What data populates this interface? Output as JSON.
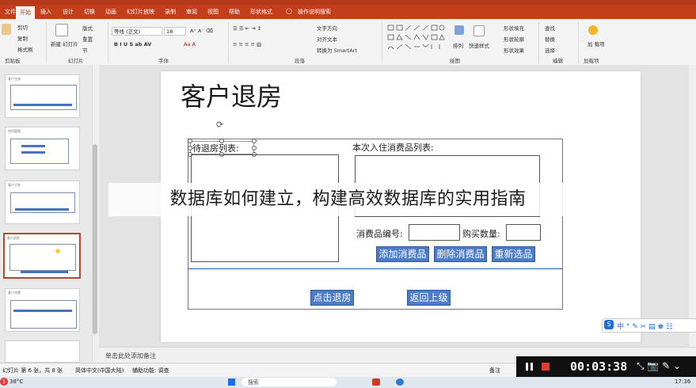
{
  "tabs": [
    "文件",
    "开始",
    "插入",
    "设计",
    "切换",
    "动画",
    "幻灯片放映",
    "录制",
    "审阅",
    "视图",
    "帮助",
    "形状格式"
  ],
  "tab_active": "开始",
  "search_hint": "操作说明搜索",
  "ribbon": {
    "clipboard": {
      "paste": "粘贴",
      "cut": "剪切",
      "copy": "复制",
      "format_painter": "格式刷",
      "label": "剪贴板"
    },
    "slides": {
      "new_slide": "新建\n幻灯片",
      "layout": "版式",
      "reset": "重置",
      "section": "节",
      "label": "幻灯片"
    },
    "font": {
      "font_name": "等线 (正文)",
      "font_size": "18",
      "label": "字体"
    },
    "paragraph": {
      "text_direction": "文字方向",
      "align_text": "对齐文本",
      "smartart": "转换为 SmartArt",
      "label": "段落"
    },
    "drawing": {
      "arrange": "排列",
      "quick_styles": "快速样式",
      "shape_fill": "形状填充",
      "shape_outline": "形状轮廓",
      "shape_effects": "形状效果",
      "label": "绘图"
    },
    "editing": {
      "find": "查找",
      "replace": "替换",
      "select": "选择",
      "label": "编辑"
    },
    "addins": {
      "addins_btn": "加\n载项",
      "label": "加载项"
    }
  },
  "thumbnails": [
    {
      "title": "客户注册"
    },
    {
      "title": "房间管理"
    },
    {
      "title": "客户订房"
    },
    {
      "title": "客户退房"
    },
    {
      "title": "客户消费"
    },
    {
      "title": ""
    }
  ],
  "slide": {
    "title": "客户退房",
    "list_label_left": "待退房列表:",
    "list_label_right": "本次入住消费品列表:",
    "item_no_label": "消费品编号:",
    "qty_label": "购买数量:",
    "btn_add": "添加消费品",
    "btn_delete": "删除消费品",
    "btn_reselect": "重新选品",
    "btn_checkout": "点击退房",
    "btn_back": "返回上级"
  },
  "banner": "数据库如何建立，构建高效数据库的实用指南",
  "notes_placeholder": "单击此处添加备注",
  "status": {
    "slide_info": "幻灯片 第 6 张，共 8 张",
    "language": "简体中文(中国大陆)",
    "accessibility": "辅助功能: 调查",
    "notes_btn": "备注"
  },
  "recorder": {
    "time": "00:03:38"
  },
  "taskbar": {
    "weather": "38°C",
    "search": "搜索",
    "clock": "17:36"
  },
  "colors": {
    "accent": "#c43e1c",
    "button_blue": "#4d7cc7",
    "selection_border": "#b7472a"
  }
}
